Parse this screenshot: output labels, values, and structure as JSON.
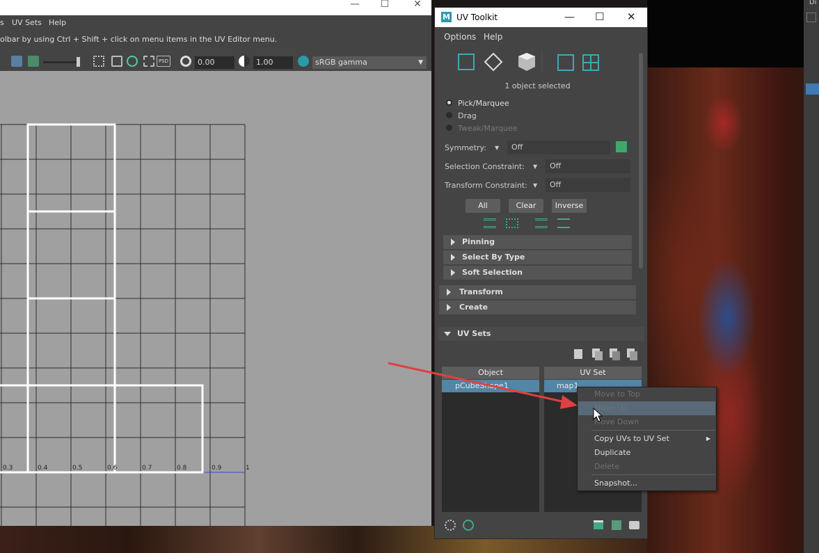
{
  "uv_editor": {
    "menu": [
      "s",
      "UV Sets",
      "Help"
    ],
    "hint": "olbar by using Ctrl + Shift + click on menu items in the UV Editor menu.",
    "exposure": "0.00",
    "gamma": "1.00",
    "color_space": "sRGB gamma",
    "axis_ticks": [
      "0.3",
      "0.4",
      "0.5",
      "0.6",
      "0.7",
      "0.8",
      "0.9",
      "1"
    ]
  },
  "toolkit": {
    "title": "UV Toolkit",
    "logo": "M",
    "menu": [
      "Options",
      "Help"
    ],
    "selection_status": "1 object selected",
    "modes": [
      {
        "label": "Pick/Marquee",
        "selected": true,
        "enabled": true
      },
      {
        "label": "Drag",
        "selected": false,
        "enabled": true
      },
      {
        "label": "Tweak/Marquee",
        "selected": false,
        "enabled": false
      }
    ],
    "symmetry": {
      "label": "Symmetry:",
      "value": "Off"
    },
    "selection_constraint": {
      "label": "Selection Constraint:",
      "value": "Off"
    },
    "transform_constraint": {
      "label": "Transform Constraint:",
      "value": "Off"
    },
    "buttons": [
      "All",
      "Clear",
      "Inverse"
    ],
    "sub_sections": [
      "Pinning",
      "Select By Type",
      "Soft Selection"
    ],
    "sections": [
      "Transform",
      "Create"
    ],
    "uv_sets": {
      "title": "UV Sets",
      "object_header": "Object",
      "uvset_header": "UV Set",
      "object_row": "pCubeShape1",
      "uvset_row": "map1"
    }
  },
  "context_menu": {
    "items": [
      "Move to Top",
      "Move Up",
      "Move Down",
      "Copy UVs to UV Set",
      "Duplicate",
      "Delete",
      "Snapshot..."
    ],
    "submenu_arrow": "▶"
  },
  "right_strip_text": "Di",
  "colors": {
    "accent": "#5285a6",
    "highlight": "#586a7a",
    "arrow": "#e04040",
    "teal": "#2a9aa8"
  }
}
